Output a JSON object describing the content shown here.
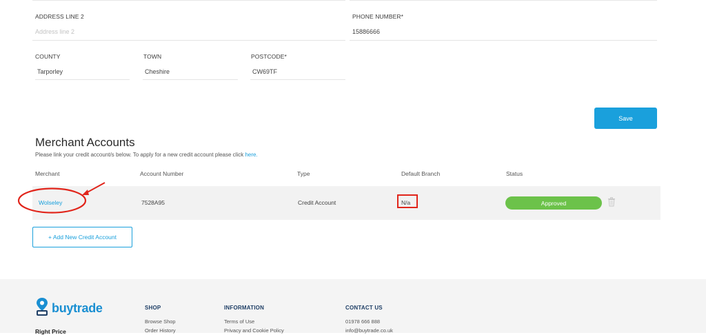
{
  "form": {
    "address_line_2": {
      "label": "ADDRESS LINE 2",
      "placeholder": "Address line 2",
      "value": ""
    },
    "phone_number": {
      "label": "PHONE NUMBER*",
      "value": "15886666"
    },
    "county": {
      "label": "COUNTY",
      "value": "Tarporley"
    },
    "town": {
      "label": "TOWN",
      "value": "Cheshire"
    },
    "postcode": {
      "label": "POSTCODE*",
      "value": "CW69TF"
    },
    "save_label": "Save"
  },
  "merchant_accounts": {
    "title": "Merchant Accounts",
    "description": "Please link your credit account/s below. To apply for a new credit account please click",
    "link_text": "here.",
    "columns": [
      "Merchant",
      "Account Number",
      "Type",
      "Default Branch",
      "Status"
    ],
    "rows": [
      {
        "merchant": "Wolseley",
        "account_number": "7528A95",
        "type": "Credit Account",
        "default_branch": "N/a",
        "status": "Approved"
      }
    ],
    "add_label": "+ Add New Credit Account"
  },
  "annotations": {
    "color": "#e1251b"
  },
  "footer": {
    "logo_text": "buytrade",
    "tagline": "Right Price",
    "shop": {
      "heading": "SHOP",
      "links": [
        "Browse Shop",
        "Order History"
      ]
    },
    "information": {
      "heading": "INFORMATION",
      "links": [
        "Terms of Use",
        "Privacy and Cookie Policy"
      ]
    },
    "contact": {
      "heading": "CONTACT US",
      "phone": "01978 666 888",
      "email": "info@buytrade.co.uk"
    }
  },
  "colors": {
    "accent": "#1aa0dc",
    "approved": "#6cc24a",
    "footer_bg": "#f4f4f4"
  }
}
